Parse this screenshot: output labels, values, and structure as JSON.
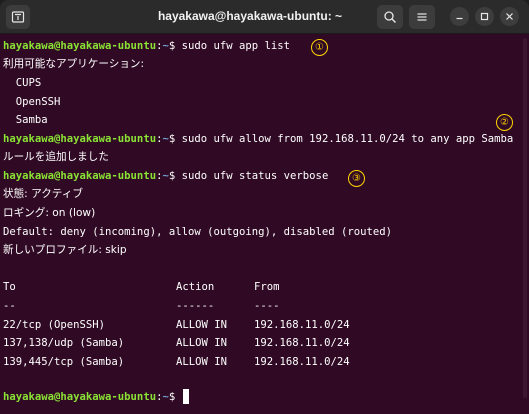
{
  "window": {
    "title": "hayakawa@hayakawa-ubuntu: ~",
    "accent": "#300a24"
  },
  "prompt": {
    "user_host": "hayakawa@hayakawa-ubuntu",
    "sep": ":",
    "cwd": "~",
    "sigil": "$ "
  },
  "commands": {
    "c1": "sudo ufw app list",
    "c2": "sudo ufw allow from 192.168.11.0/24 to any app Samba",
    "c3": "sudo ufw status verbose"
  },
  "output": {
    "apps_header": "利用可能なアプリケーション:",
    "app1": "  CUPS",
    "app2": "  OpenSSH",
    "app3": "  Samba",
    "rule_added": "ルールを追加しました",
    "status": "状態: アクティブ",
    "logging": "ロギング: on (low)",
    "default": "Default: deny (incoming), allow (outgoing), disabled (routed)",
    "new_profile": "新しいプロファイル: skip"
  },
  "table": {
    "headers": {
      "to": "To",
      "action": "Action",
      "from": "From"
    },
    "dashes": {
      "to": "--",
      "action": "------",
      "from": "----"
    },
    "rows": [
      {
        "to": "22/tcp (OpenSSH)",
        "action": "ALLOW IN",
        "from": "192.168.11.0/24"
      },
      {
        "to": "137,138/udp (Samba)",
        "action": "ALLOW IN",
        "from": "192.168.11.0/24"
      },
      {
        "to": "139,445/tcp (Samba)",
        "action": "ALLOW IN",
        "from": "192.168.11.0/24"
      }
    ]
  },
  "markers": {
    "m1": "①",
    "m2": "②",
    "m3": "③"
  },
  "icons": {
    "new_tab": "new-tab-icon",
    "search": "search-icon",
    "menu": "hamburger-menu-icon",
    "minimize": "minimize-icon",
    "maximize": "maximize-icon",
    "close": "close-icon"
  }
}
